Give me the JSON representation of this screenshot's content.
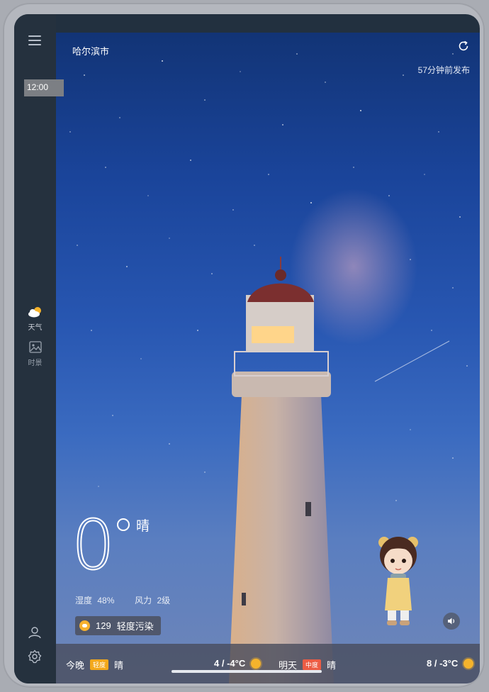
{
  "sidebar": {
    "time": "12:00",
    "nav": [
      {
        "label": "天气",
        "icon": "partly-cloudy-icon"
      },
      {
        "label": "时景",
        "icon": "image-icon"
      }
    ],
    "bottom_icons": [
      "user-icon",
      "settings-icon"
    ]
  },
  "header": {
    "city": "哈尔滨市",
    "published": "57分钟前发布"
  },
  "current": {
    "temperature": "0",
    "condition": "晴",
    "humidity_label": "湿度",
    "humidity_value": "48%",
    "wind_label": "风力",
    "wind_value": "2级",
    "aqi_value": "129",
    "aqi_text": "轻度污染"
  },
  "forecast": [
    {
      "day": "今晚",
      "badge": "轻度",
      "condition": "晴",
      "range": "4 / -4°C"
    },
    {
      "day": "明天",
      "badge": "中度",
      "condition": "晴",
      "range": "8 / -3°C"
    }
  ],
  "colors": {
    "sidebar": "#25313e",
    "sky_top": "#123476",
    "badge_light": "#f3a81b",
    "badge_mid": "#ec5c44",
    "sun": "#f4b32c"
  }
}
